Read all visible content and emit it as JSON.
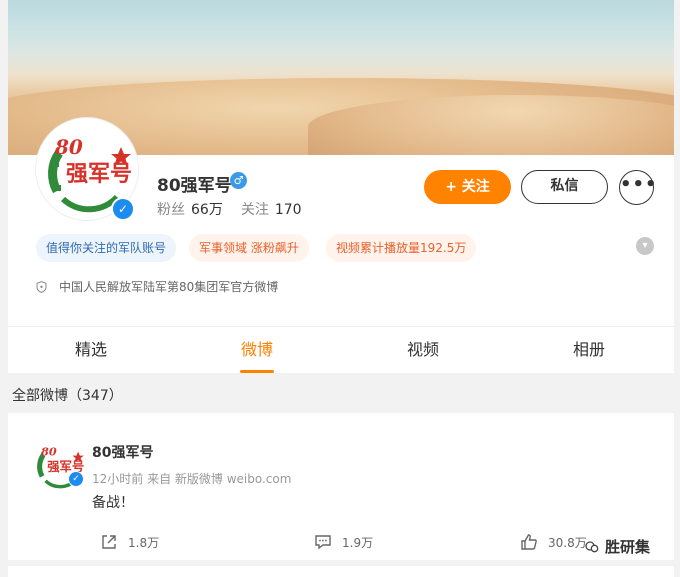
{
  "profile": {
    "name": "80强军号",
    "fans_label": "粉丝",
    "fans_count": "66万",
    "follow_label": "关注",
    "follow_count": "170",
    "description": "中国人民解放军陆军第80集团军官方微博"
  },
  "buttons": {
    "follow": "+ 关注",
    "message": "私信",
    "more": "•••"
  },
  "tags": [
    "值得你关注的军队账号",
    "军事领域 涨粉飙升",
    "视频累计播放量192.5万"
  ],
  "tabs": {
    "items": [
      "精选",
      "微博",
      "视频",
      "相册"
    ],
    "active": "微博"
  },
  "section": {
    "title": "全部微博（347）"
  },
  "post": {
    "name": "80强军号",
    "meta": "12小时前  来自 新版微博 weibo.com",
    "body": "备战！",
    "repost": "1.8万",
    "comment": "1.9万",
    "like": "30.8万"
  },
  "watermark": "胜研集",
  "colors": {
    "accent": "#ff8200",
    "verified": "#1d8cf0",
    "logo_green": "#2f8a3a",
    "logo_red": "#d6322a"
  }
}
